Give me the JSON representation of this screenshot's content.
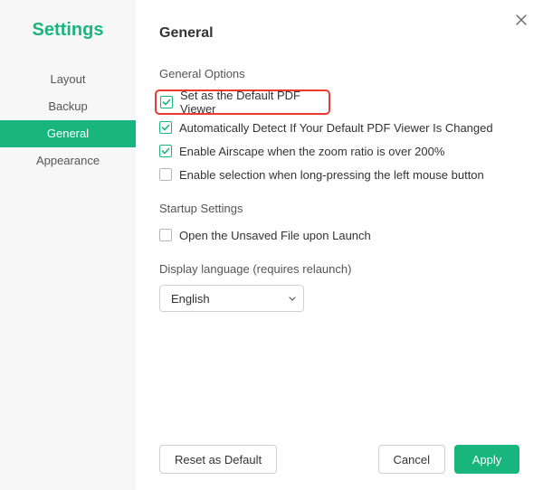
{
  "title": "Settings",
  "nav": {
    "items": [
      {
        "label": "Layout",
        "active": false
      },
      {
        "label": "Backup",
        "active": false
      },
      {
        "label": "General",
        "active": true
      },
      {
        "label": "Appearance",
        "active": false
      }
    ]
  },
  "page": {
    "heading": "General",
    "sections": {
      "general_options_label": "General Options",
      "startup_label": "Startup Settings",
      "language_label": "Display language (requires relaunch)"
    },
    "options": {
      "default_viewer": {
        "label": "Set as the Default PDF Viewer",
        "checked": true
      },
      "auto_detect": {
        "label": "Automatically Detect If Your Default PDF Viewer Is Changed",
        "checked": true
      },
      "airscape": {
        "label": "Enable Airscape when the zoom ratio is over 200%",
        "checked": true
      },
      "longpress": {
        "label": "Enable selection when long-pressing the left mouse button",
        "checked": false
      },
      "open_unsaved": {
        "label": "Open the Unsaved File upon Launch",
        "checked": false
      }
    },
    "language": {
      "selected": "English"
    }
  },
  "footer": {
    "reset": "Reset as Default",
    "cancel": "Cancel",
    "apply": "Apply"
  }
}
